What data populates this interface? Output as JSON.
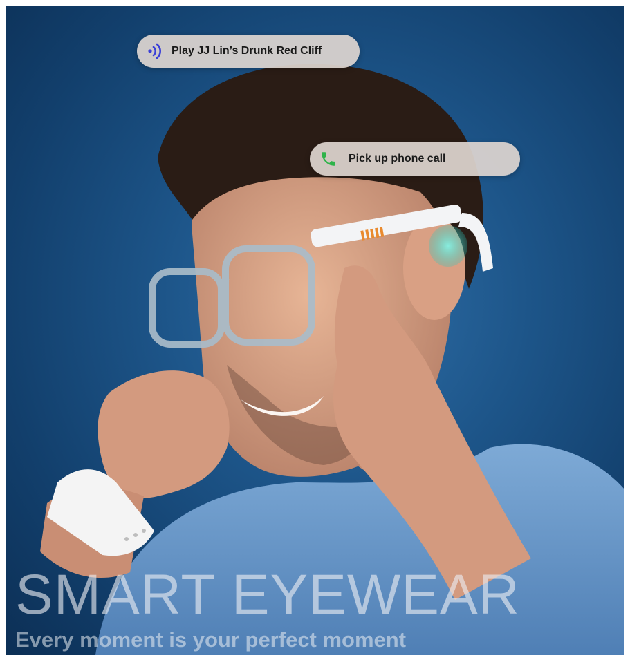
{
  "bubbles": {
    "voice": {
      "text": "Play JJ Lin’s Drunk Red Cliff",
      "icon": "sound-wave-icon",
      "icon_color": "#3a3fd8"
    },
    "call": {
      "text": "Pick up phone call",
      "icon": "phone-icon",
      "icon_color": "#2fb34a"
    }
  },
  "headline": "SMART EYEWEAR",
  "tagline": "Every moment is your perfect moment",
  "colors": {
    "background": "#1d5589",
    "shirt": "#6f9fd0",
    "temple_accent": "#e98a2f",
    "ear_glow": "#3fe0d0"
  }
}
